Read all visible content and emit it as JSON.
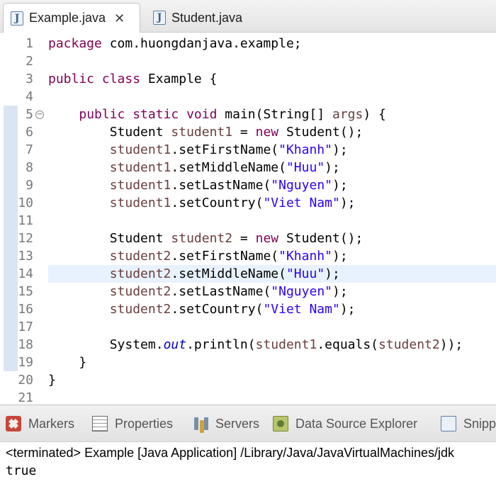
{
  "editor_tabs": [
    {
      "label": "Example.java",
      "active": true
    },
    {
      "label": "Student.java",
      "active": false
    }
  ],
  "icons": {
    "java_file": "J",
    "close": "✕",
    "fold": "−"
  },
  "colors": {
    "keyword": "#7f0055",
    "string": "#2a00ff",
    "variable": "#6a3e3e",
    "field": "#0000c0",
    "line_number": "#787878",
    "current_line": "#e8f2fe"
  },
  "current_line_number": 14,
  "code_lines": [
    {
      "n": "1",
      "tokens": [
        {
          "t": "kw",
          "v": "package"
        },
        {
          "t": "plain",
          "v": " com.huongdanjava.example;"
        }
      ]
    },
    {
      "n": "2",
      "tokens": []
    },
    {
      "n": "3",
      "tokens": [
        {
          "t": "kw",
          "v": "public class"
        },
        {
          "t": "plain",
          "v": " Example {"
        }
      ]
    },
    {
      "n": "4",
      "tokens": []
    },
    {
      "n": "5",
      "fold": true,
      "tokens": [
        {
          "t": "plain",
          "v": "    "
        },
        {
          "t": "kw",
          "v": "public static void"
        },
        {
          "t": "plain",
          "v": " main(String[] "
        },
        {
          "t": "var",
          "v": "args"
        },
        {
          "t": "plain",
          "v": ") {"
        }
      ]
    },
    {
      "n": "6",
      "tokens": [
        {
          "t": "plain",
          "v": "        Student "
        },
        {
          "t": "var",
          "v": "student1"
        },
        {
          "t": "plain",
          "v": " = "
        },
        {
          "t": "kw",
          "v": "new"
        },
        {
          "t": "plain",
          "v": " Student();"
        }
      ]
    },
    {
      "n": "7",
      "tokens": [
        {
          "t": "plain",
          "v": "        "
        },
        {
          "t": "var",
          "v": "student1"
        },
        {
          "t": "plain",
          "v": ".setFirstName("
        },
        {
          "t": "str",
          "v": "\"Khanh\""
        },
        {
          "t": "plain",
          "v": ");"
        }
      ]
    },
    {
      "n": "8",
      "tokens": [
        {
          "t": "plain",
          "v": "        "
        },
        {
          "t": "var",
          "v": "student1"
        },
        {
          "t": "plain",
          "v": ".setMiddleName("
        },
        {
          "t": "str",
          "v": "\"Huu\""
        },
        {
          "t": "plain",
          "v": ");"
        }
      ]
    },
    {
      "n": "9",
      "tokens": [
        {
          "t": "plain",
          "v": "        "
        },
        {
          "t": "var",
          "v": "student1"
        },
        {
          "t": "plain",
          "v": ".setLastName("
        },
        {
          "t": "str",
          "v": "\"Nguyen\""
        },
        {
          "t": "plain",
          "v": ");"
        }
      ]
    },
    {
      "n": "10",
      "tokens": [
        {
          "t": "plain",
          "v": "        "
        },
        {
          "t": "var",
          "v": "student1"
        },
        {
          "t": "plain",
          "v": ".setCountry("
        },
        {
          "t": "str",
          "v": "\"Viet Nam\""
        },
        {
          "t": "plain",
          "v": ");"
        }
      ]
    },
    {
      "n": "11",
      "tokens": []
    },
    {
      "n": "12",
      "tokens": [
        {
          "t": "plain",
          "v": "        Student "
        },
        {
          "t": "var",
          "v": "student2"
        },
        {
          "t": "plain",
          "v": " = "
        },
        {
          "t": "kw",
          "v": "new"
        },
        {
          "t": "plain",
          "v": " Student();"
        }
      ]
    },
    {
      "n": "13",
      "tokens": [
        {
          "t": "plain",
          "v": "        "
        },
        {
          "t": "var",
          "v": "student2"
        },
        {
          "t": "plain",
          "v": ".setFirstName("
        },
        {
          "t": "str",
          "v": "\"Khanh\""
        },
        {
          "t": "plain",
          "v": ");"
        }
      ]
    },
    {
      "n": "14",
      "tokens": [
        {
          "t": "plain",
          "v": "        "
        },
        {
          "t": "var",
          "v": "student2"
        },
        {
          "t": "plain",
          "v": ".setMiddleName("
        },
        {
          "t": "str",
          "v": "\"Huu\""
        },
        {
          "t": "plain",
          "v": ");"
        }
      ]
    },
    {
      "n": "15",
      "tokens": [
        {
          "t": "plain",
          "v": "        "
        },
        {
          "t": "var",
          "v": "student2"
        },
        {
          "t": "plain",
          "v": ".setLastName("
        },
        {
          "t": "str",
          "v": "\"Nguyen\""
        },
        {
          "t": "plain",
          "v": ");"
        }
      ]
    },
    {
      "n": "16",
      "tokens": [
        {
          "t": "plain",
          "v": "        "
        },
        {
          "t": "var",
          "v": "student2"
        },
        {
          "t": "plain",
          "v": ".setCountry("
        },
        {
          "t": "str",
          "v": "\"Viet Nam\""
        },
        {
          "t": "plain",
          "v": ");"
        }
      ]
    },
    {
      "n": "17",
      "tokens": []
    },
    {
      "n": "18",
      "tokens": [
        {
          "t": "plain",
          "v": "        System."
        },
        {
          "t": "fld",
          "v": "out"
        },
        {
          "t": "plain",
          "v": ".println("
        },
        {
          "t": "var",
          "v": "student1"
        },
        {
          "t": "plain",
          "v": ".equals("
        },
        {
          "t": "var",
          "v": "student2"
        },
        {
          "t": "plain",
          "v": "));"
        }
      ]
    },
    {
      "n": "19",
      "tokens": [
        {
          "t": "plain",
          "v": "    }"
        }
      ]
    },
    {
      "n": "20",
      "tokens": [
        {
          "t": "plain",
          "v": "}"
        }
      ]
    },
    {
      "n": "21",
      "tokens": []
    }
  ],
  "panel_tabs": [
    {
      "label": "Markers",
      "icon": "markers-icon"
    },
    {
      "label": "Properties",
      "icon": "properties-icon"
    },
    {
      "label": "Servers",
      "icon": "servers-icon"
    },
    {
      "label": "Data Source Explorer",
      "icon": "datasource-icon"
    },
    {
      "label": "Snipp",
      "icon": "snippets-icon"
    }
  ],
  "console": {
    "header": "<terminated> Example [Java Application] /Library/Java/JavaVirtualMachines/jdk",
    "output": "true"
  }
}
